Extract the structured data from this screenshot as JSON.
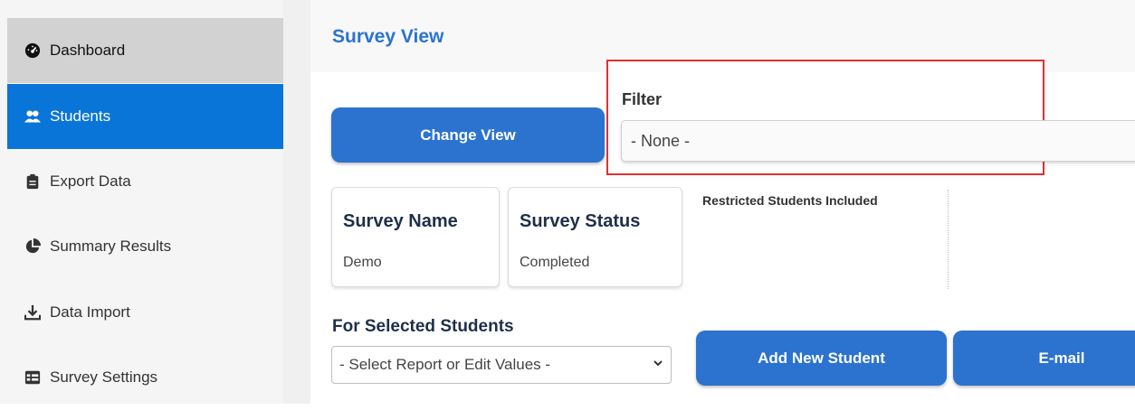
{
  "sidebar": {
    "items": [
      {
        "label": "Dashboard",
        "icon": "gauge-icon"
      },
      {
        "label": "Students",
        "icon": "users-icon"
      },
      {
        "label": "Export Data",
        "icon": "clipboard-icon"
      },
      {
        "label": "Summary Results",
        "icon": "pie-chart-icon"
      },
      {
        "label": "Data Import",
        "icon": "download-icon"
      },
      {
        "label": "Survey Settings",
        "icon": "table-icon"
      }
    ],
    "active_index": 1
  },
  "main": {
    "title": "Survey View",
    "change_view_label": "Change View",
    "filter": {
      "label": "Filter",
      "selected": "- None -"
    },
    "cards": [
      {
        "label": "Survey Name",
        "value": "Demo"
      },
      {
        "label": "Survey Status",
        "value": "Completed"
      }
    ],
    "restricted_label": "Restricted Students Included",
    "selected_students": {
      "title": "For Selected Students",
      "select_value": "- Select Report or Edit Values -"
    },
    "add_student_label": "Add New Student",
    "email_label": "E-mail"
  },
  "colors": {
    "accent": "#2b73cf",
    "active_nav": "#0a75d8",
    "highlight_border": "#e03131"
  }
}
